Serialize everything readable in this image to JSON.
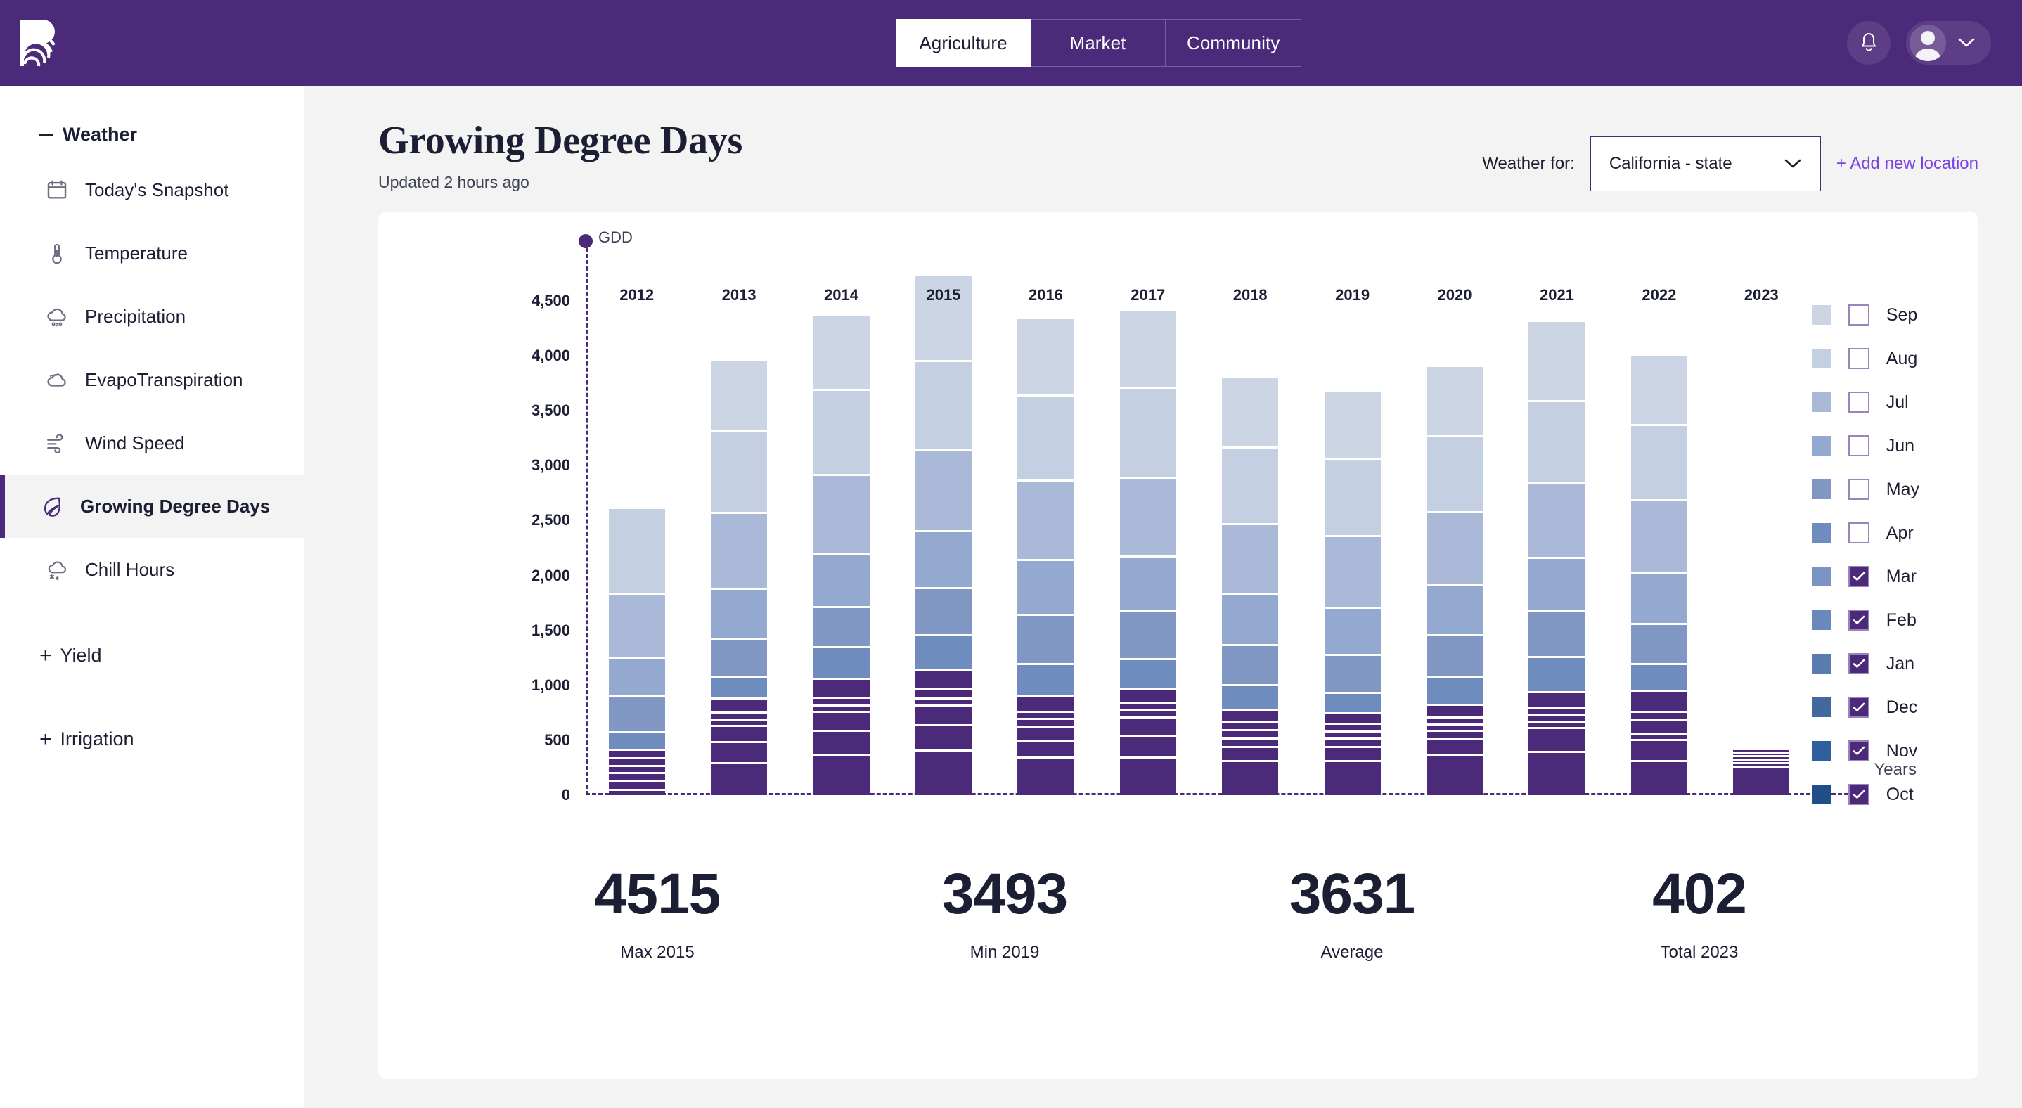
{
  "topbar": {
    "logo_name": "brand-logo",
    "tabs": [
      {
        "label": "Agriculture",
        "active": true
      },
      {
        "label": "Market",
        "active": false
      },
      {
        "label": "Community",
        "active": false
      }
    ],
    "bell_icon": "bell-icon",
    "avatar_icon": "user-avatar-icon",
    "chevron_icon": "chevron-down-icon"
  },
  "sidebar": {
    "weather_group": "Weather",
    "items": [
      {
        "label": "Today's Snapshot",
        "icon": "calendar-icon",
        "active": false
      },
      {
        "label": "Temperature",
        "icon": "thermometer-icon",
        "active": false
      },
      {
        "label": "Precipitation",
        "icon": "rain-cloud-icon",
        "active": false
      },
      {
        "label": "EvapoTranspiration",
        "icon": "evaporation-cloud-icon",
        "active": false
      },
      {
        "label": "Wind Speed",
        "icon": "wind-icon",
        "active": false
      },
      {
        "label": "Growing Degree Days",
        "icon": "leaf-icon",
        "active": true
      },
      {
        "label": "Chill Hours",
        "icon": "snow-cloud-icon",
        "active": false
      }
    ],
    "yield_group": "Yield",
    "irrigation_group": "Irrigation"
  },
  "header": {
    "title": "Growing Degree Days",
    "updated": "Updated 2 hours ago",
    "weather_for_label": "Weather for:",
    "location_value": "California - state",
    "add_location_label": "+ Add new location",
    "accent_purple": "#4c2a7a",
    "link_purple": "#7b3fe4"
  },
  "chart_data": {
    "type": "bar",
    "stacked": true,
    "title": "",
    "xlabel": "Years",
    "ylabel": "GDD",
    "ylim": [
      0,
      4800
    ],
    "yticks": [
      "0",
      "500",
      "1,000",
      "1,500",
      "2,000",
      "2,500",
      "3,000",
      "3,500",
      "4,000",
      "4,500"
    ],
    "ytick_values": [
      0,
      500,
      1000,
      1500,
      2000,
      2500,
      3000,
      3500,
      4000,
      4500
    ],
    "grid": false,
    "legend_position": "right",
    "categories": [
      "2012",
      "2013",
      "2014",
      "2015",
      "2016",
      "2017",
      "2018",
      "2019",
      "2020",
      "2021",
      "2022",
      "2023"
    ],
    "series": [
      {
        "name": "Oct",
        "color": "#1f4e89",
        "checked": true,
        "values": [
          40,
          280,
          350,
          395,
          330,
          330,
          300,
          300,
          350,
          385,
          300,
          245
        ]
      },
      {
        "name": "Nov",
        "color": "#2f5f9c",
        "checked": true,
        "values": [
          55,
          175,
          210,
          215,
          130,
          180,
          110,
          110,
          130,
          195,
          175,
          18
        ]
      },
      {
        "name": "Dec",
        "color": "#41699f",
        "checked": true,
        "values": [
          60,
          130,
          150,
          160,
          110,
          150,
          55,
          55,
          60,
          40,
          35,
          12
        ]
      },
      {
        "name": "Jan",
        "color": "#5a7bb0",
        "checked": true,
        "values": [
          45,
          35,
          40,
          45,
          55,
          45,
          60,
          50,
          35,
          45,
          110,
          10
        ]
      },
      {
        "name": "Feb",
        "color": "#6a88bb",
        "checked": true,
        "values": [
          50,
          45,
          50,
          60,
          50,
          50,
          50,
          50,
          45,
          45,
          55,
          8
        ]
      },
      {
        "name": "Mar",
        "color": "#7b94c2",
        "checked": true,
        "values": [
          60,
          110,
          155,
          165,
          125,
          105,
          90,
          75,
          100,
          120,
          170,
          6
        ]
      },
      {
        "name": "Apr",
        "color": "#6e8cbe",
        "checked": false,
        "values": [
          135,
          180,
          270,
          290,
          270,
          255,
          215,
          165,
          235,
          300,
          225,
          0
        ]
      },
      {
        "name": "May",
        "color": "#8097c4",
        "checked": false,
        "values": [
          315,
          320,
          345,
          410,
          430,
          415,
          345,
          330,
          360,
          400,
          345,
          0
        ]
      },
      {
        "name": "Jun",
        "color": "#94a9cf",
        "checked": false,
        "values": [
          330,
          440,
          460,
          500,
          480,
          480,
          440,
          410,
          440,
          465,
          450,
          0
        ]
      },
      {
        "name": "Jul",
        "color": "#aab9d7",
        "checked": false,
        "values": [
          560,
          675,
          700,
          720,
          700,
          700,
          620,
          630,
          640,
          660,
          640,
          0
        ]
      },
      {
        "name": "Aug",
        "color": "#c5cfe2",
        "checked": false,
        "values": [
          760,
          720,
          760,
          790,
          760,
          800,
          680,
          680,
          670,
          730,
          660,
          0
        ]
      },
      {
        "name": "Sep",
        "color": "#ccd5e4",
        "checked": false,
        "values": [
          0,
          630,
          660,
          765,
          680,
          680,
          620,
          600,
          620,
          710,
          620,
          0
        ]
      }
    ],
    "legend_order": [
      "Sep",
      "Aug",
      "Jul",
      "Jun",
      "May",
      "Apr",
      "Mar",
      "Feb",
      "Jan",
      "Dec",
      "Nov",
      "Oct"
    ]
  },
  "stats": [
    {
      "value": "4515",
      "label": "Max 2015"
    },
    {
      "value": "3493",
      "label": "Min 2019"
    },
    {
      "value": "3631",
      "label": "Average"
    },
    {
      "value": "402",
      "label": "Total 2023"
    }
  ]
}
